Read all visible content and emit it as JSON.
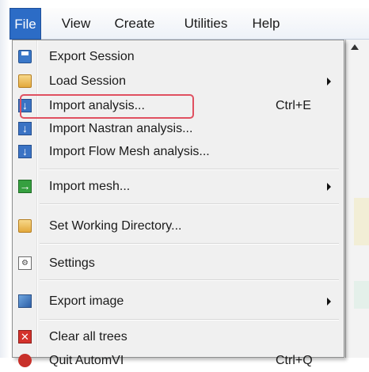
{
  "menubar": {
    "items": [
      {
        "label": "File",
        "active": true
      },
      {
        "label": "View",
        "active": false
      },
      {
        "label": "Create",
        "active": false
      },
      {
        "label": "Utilities",
        "active": false
      },
      {
        "label": "Help",
        "active": false
      }
    ]
  },
  "file_menu": {
    "items": [
      {
        "label": "Export Session",
        "icon": "floppy-icon"
      },
      {
        "label": "Load Session",
        "icon": "folder-icon",
        "submenu": true
      },
      {
        "label": "Import analysis...",
        "icon": "import-icon",
        "shortcut": "Ctrl+E",
        "highlighted": true
      },
      {
        "label": "Import Nastran analysis...",
        "icon": "import-icon"
      },
      {
        "label": "Import Flow Mesh analysis...",
        "icon": "import-icon"
      },
      {
        "label": "Import mesh...",
        "icon": "mesh-arrow-icon",
        "submenu": true
      },
      {
        "label": "Set Working Directory...",
        "icon": "folder-icon"
      },
      {
        "label": "Settings",
        "icon": "settings-icon"
      },
      {
        "label": "Export image",
        "icon": "export-image-icon",
        "submenu": true
      },
      {
        "label": "Clear all trees",
        "icon": "clear-icon"
      },
      {
        "label": "Quit AutomVI",
        "icon": "quit-icon",
        "shortcut": "Ctrl+Q"
      }
    ]
  },
  "colors": {
    "menubar_active": "#2c6cc6",
    "highlight_border": "#e05060",
    "menu_background": "#f0f0f0"
  }
}
